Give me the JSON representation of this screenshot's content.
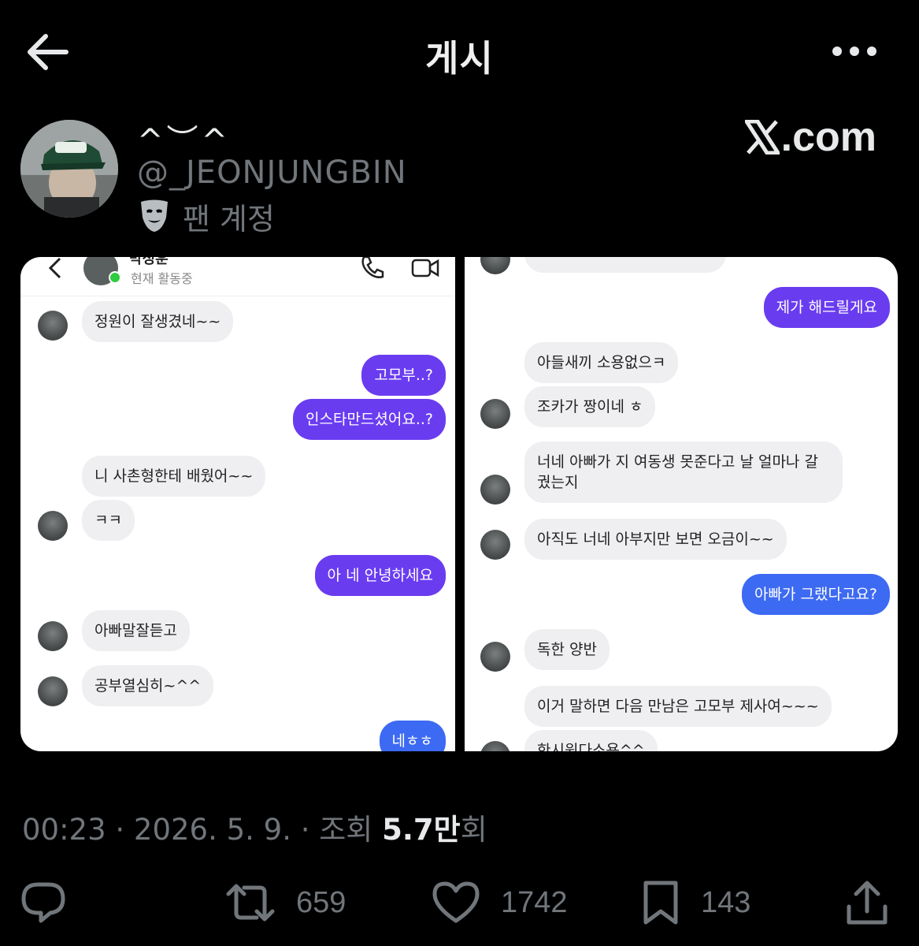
{
  "header": {
    "title": "게시"
  },
  "author": {
    "display_name": "^︶^",
    "handle": "@_JEONJUNGBIN",
    "account_label": "팬 계정",
    "brand": ".com"
  },
  "screenshot_left": {
    "contact_name": "박정훈",
    "contact_status": "현재 활동중",
    "messages": [
      {
        "from": "them",
        "text": "정원이 잘생겼네~~"
      },
      {
        "from": "me",
        "text": "고모부..?"
      },
      {
        "from": "me",
        "text": "인스타만드셨어요..?"
      },
      {
        "from": "them",
        "text": "니 사촌형한테 배웠어~~"
      },
      {
        "from": "them",
        "text": "ㅋㅋ"
      },
      {
        "from": "me",
        "text": "아 네 안녕하세요"
      },
      {
        "from": "them",
        "text": "아빠말잘듣고"
      },
      {
        "from": "them",
        "text": "공부열심히~^^"
      },
      {
        "from": "me",
        "text": "네ㅎㅎ"
      }
    ]
  },
  "screenshot_right": {
    "messages": [
      {
        "from": "me",
        "text": "제가 해드릴게요"
      },
      {
        "from": "them",
        "text": "아들새끼 소용없으ㅋ"
      },
      {
        "from": "them",
        "text": "조카가 짱이네 ㅎ"
      },
      {
        "from": "them",
        "text": "너네 아빠가 지 여동생 못준다고 날 얼마나 갈궜는지"
      },
      {
        "from": "them",
        "text": "아직도 너네 아부지만 보면 오금이~~"
      },
      {
        "from": "me",
        "text": "아빠가 그랬다고요?"
      },
      {
        "from": "them",
        "text": "독한 양반"
      },
      {
        "from": "them",
        "text": "이거 말하면 다음 만남은 고모부 제사여~~~"
      },
      {
        "from": "them",
        "text": "한시원다소용^^"
      }
    ]
  },
  "meta": {
    "time": "00:23 · 2026. 5. 9. · 조회 ",
    "views": "5.7만",
    "views_suffix": "회"
  },
  "actions": {
    "reply_count": "",
    "retweet_count": "659",
    "like_count": "1742",
    "bookmark_count": "143"
  }
}
